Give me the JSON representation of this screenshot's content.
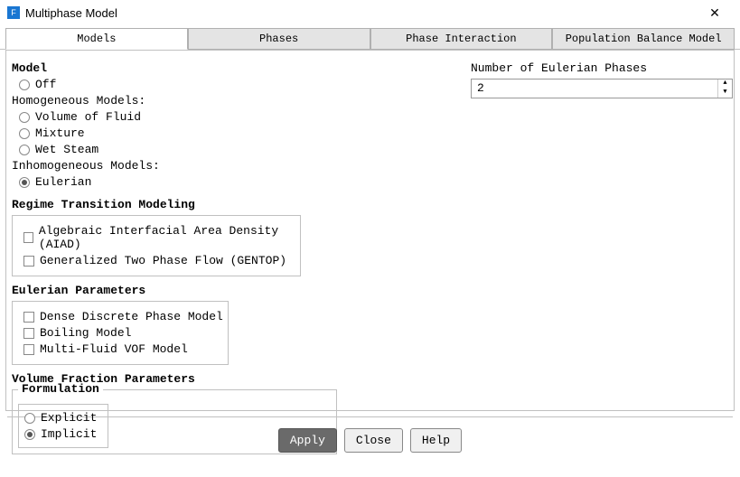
{
  "window": {
    "title": "Multiphase Model",
    "icon_letter": "F"
  },
  "tabs": {
    "t0": "Models",
    "t1": "Phases",
    "t2": "Phase Interaction",
    "t3": "Population Balance Model"
  },
  "model": {
    "heading": "Model",
    "off": "Off",
    "homog_label": "Homogeneous Models:",
    "vof": "Volume of Fluid",
    "mixture": "Mixture",
    "wet_steam": "Wet Steam",
    "inhomog_label": "Inhomogeneous Models:",
    "eulerian": "Eulerian"
  },
  "rtm": {
    "heading": "Regime Transition Modeling",
    "aiad": "Algebraic Interfacial Area Density (AIAD)",
    "gentop": "Generalized Two Phase Flow (GENTOP)"
  },
  "eparams": {
    "heading": "Eulerian Parameters",
    "ddpm": "Dense Discrete Phase Model",
    "boiling": "Boiling Model",
    "mfvof": "Multi-Fluid VOF Model"
  },
  "vfp": {
    "heading": "Volume Fraction Parameters",
    "legend": "Formulation",
    "explicit": "Explicit",
    "implicit": "Implicit"
  },
  "phases": {
    "label": "Number of Eulerian Phases",
    "value": "2"
  },
  "buttons": {
    "apply": "Apply",
    "close": "Close",
    "help": "Help"
  }
}
